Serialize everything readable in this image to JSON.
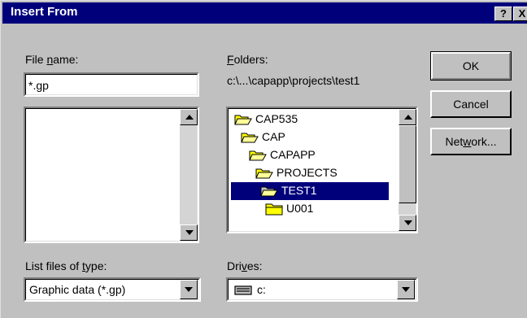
{
  "dialog": {
    "title": "Insert From",
    "help_glyph": "?",
    "close_glyph": "X"
  },
  "filename": {
    "label_pre": "File ",
    "label_accel": "n",
    "label_post": "ame:",
    "value": "*.gp"
  },
  "folders": {
    "label_accel": "F",
    "label_post": "olders:",
    "current_path": "c:\\...\\capapp\\projects\\test1",
    "items": [
      {
        "name": "CAP535",
        "state": "open"
      },
      {
        "name": "CAP",
        "state": "open"
      },
      {
        "name": "CAPAPP",
        "state": "open"
      },
      {
        "name": "PROJECTS",
        "state": "open"
      },
      {
        "name": "TEST1",
        "state": "open-selected"
      },
      {
        "name": "U001",
        "state": "closed"
      }
    ]
  },
  "buttons": {
    "ok": "OK",
    "cancel": "Cancel",
    "network_pre": "Net",
    "network_accel": "w",
    "network_post": "ork..."
  },
  "file_type": {
    "label_pre": "List files of ",
    "label_accel": "t",
    "label_post": "ype:",
    "value": "Graphic data (*.gp)"
  },
  "drives": {
    "label_pre": "Dri",
    "label_accel": "v",
    "label_post": "es:",
    "value": "c:",
    "icon": "drive-icon"
  },
  "colors": {
    "title_bar": "#00007b",
    "face": "#c0c0c0",
    "selection": "#00007b"
  }
}
